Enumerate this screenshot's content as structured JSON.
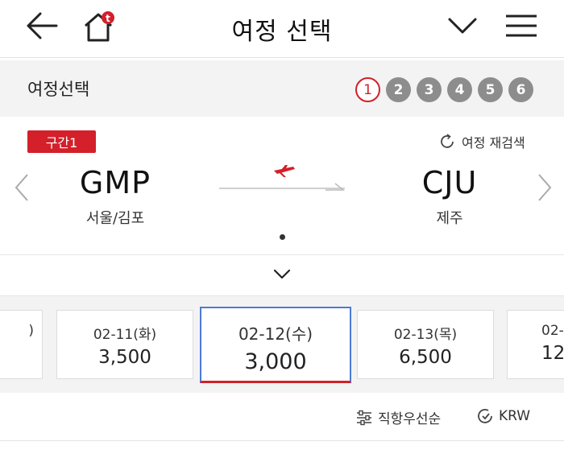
{
  "header": {
    "title": "여정 선택",
    "back_icon": "back-arrow-icon",
    "home_icon": "home-icon",
    "expand_icon": "chevron-down-icon",
    "menu_icon": "menu-icon"
  },
  "stepbar": {
    "label": "여정선택",
    "steps": [
      "1",
      "2",
      "3",
      "4",
      "5",
      "6"
    ],
    "active_step": 1,
    "accent_color": "#d3202a"
  },
  "segment": {
    "badge": "구간1",
    "research_label": "여정 재검색",
    "departure": {
      "code": "GMP",
      "name": "서울/김포"
    },
    "arrival": {
      "code": "CJU",
      "name": "제주"
    }
  },
  "dates": [
    {
      "date": ")",
      "price": ""
    },
    {
      "date": "02-11(화)",
      "price": "3,500"
    },
    {
      "date": "02-12(수)",
      "price": "3,000",
      "selected": true
    },
    {
      "date": "02-13(목)",
      "price": "6,500"
    },
    {
      "date": "02-",
      "price": "12"
    }
  ],
  "sort": {
    "label": "직항우선순",
    "currency": "KRW"
  }
}
